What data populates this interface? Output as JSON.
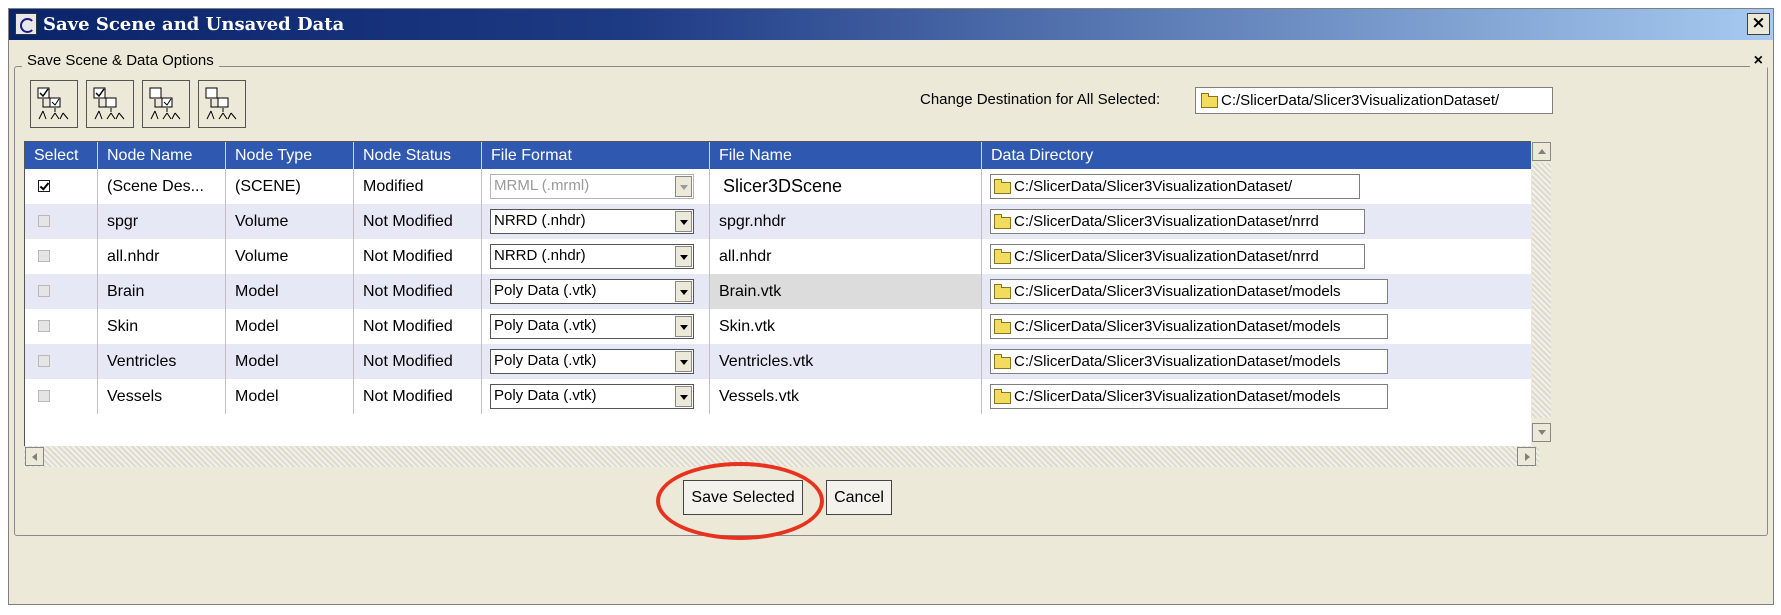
{
  "window": {
    "title": "Save Scene and Unsaved Data",
    "close_glyph": "×"
  },
  "group": {
    "label": "Save Scene & Data Options",
    "collapse_glyph": "×"
  },
  "toolbar": {
    "buttons": [
      "select-all-icon",
      "select-modified-icon",
      "select-data-icon",
      "deselect-all-icon"
    ]
  },
  "destination": {
    "label": "Change Destination for All Selected:",
    "value": "C:/SlicerData/Slicer3VisualizationDataset/"
  },
  "table": {
    "headers": [
      "Select",
      "Node Name",
      "Node Type",
      "Node Status",
      "File Format",
      "File Name",
      "Data Directory"
    ],
    "rows": [
      {
        "selected": true,
        "node_name": "(Scene Des...",
        "node_type": "(SCENE)",
        "node_status": "Modified",
        "file_format": "MRML (.mrml)",
        "format_enabled": false,
        "file_name": "Slicer3DScene",
        "data_directory": "C:/SlicerData/Slicer3VisualizationDataset/"
      },
      {
        "selected": false,
        "node_name": "spgr",
        "node_type": "Volume",
        "node_status": "Not Modified",
        "file_format": "NRRD (.nhdr)",
        "format_enabled": true,
        "file_name": "spgr.nhdr",
        "data_directory": "C:/SlicerData/Slicer3VisualizationDataset/nrrd"
      },
      {
        "selected": false,
        "node_name": "all.nhdr",
        "node_type": "Volume",
        "node_status": "Not Modified",
        "file_format": "NRRD (.nhdr)",
        "format_enabled": true,
        "file_name": "all.nhdr",
        "data_directory": "C:/SlicerData/Slicer3VisualizationDataset/nrrd"
      },
      {
        "selected": false,
        "node_name": "Brain",
        "node_type": "Model",
        "node_status": "Not Modified",
        "file_format": "Poly Data (.vtk)",
        "format_enabled": true,
        "file_name": "Brain.vtk",
        "data_directory": "C:/SlicerData/Slicer3VisualizationDataset/models"
      },
      {
        "selected": false,
        "node_name": "Skin",
        "node_type": "Model",
        "node_status": "Not Modified",
        "file_format": "Poly Data (.vtk)",
        "format_enabled": true,
        "file_name": "Skin.vtk",
        "data_directory": "C:/SlicerData/Slicer3VisualizationDataset/models"
      },
      {
        "selected": false,
        "node_name": "Ventricles",
        "node_type": "Model",
        "node_status": "Not Modified",
        "file_format": "Poly Data (.vtk)",
        "format_enabled": true,
        "file_name": "Ventricles.vtk",
        "data_directory": "C:/SlicerData/Slicer3VisualizationDataset/models"
      },
      {
        "selected": false,
        "node_name": "Vessels",
        "node_type": "Model",
        "node_status": "Not Modified",
        "file_format": "Poly Data (.vtk)",
        "format_enabled": true,
        "file_name": "Vessels.vtk",
        "data_directory": "C:/SlicerData/Slicer3VisualizationDataset/models"
      }
    ]
  },
  "actions": {
    "save_label": "Save Selected",
    "cancel_label": "Cancel"
  },
  "colors": {
    "title_bar": "#0a246a",
    "header_bg": "#2f59b1",
    "alt_row": "#e6e8f6",
    "highlight_ring": "#e8321e"
  }
}
